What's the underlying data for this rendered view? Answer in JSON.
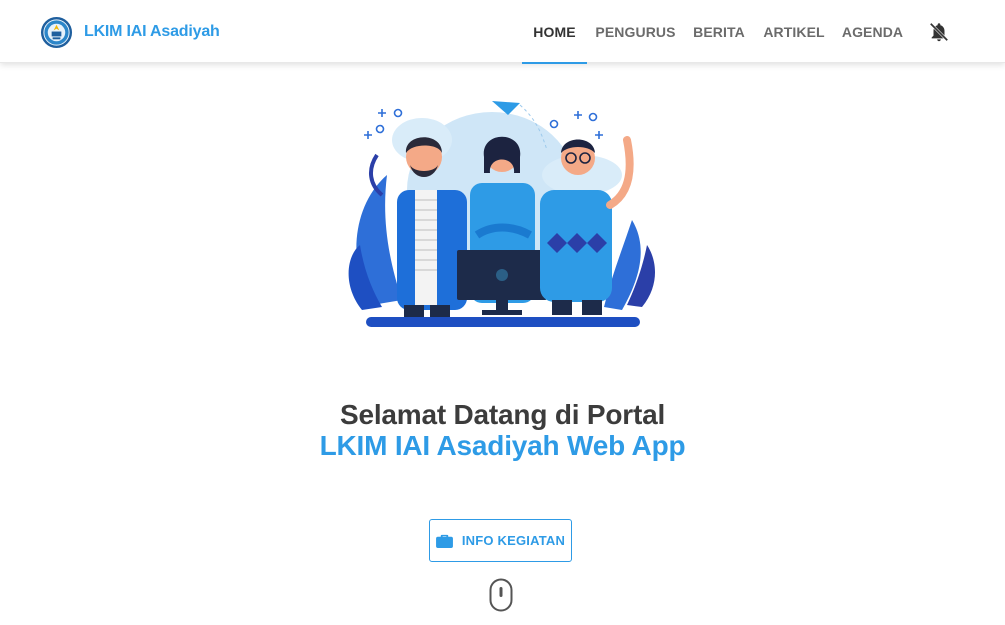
{
  "brand": {
    "name": "LKIM IAI Asadiyah",
    "logo_icon": "university-seal-icon"
  },
  "nav": {
    "items": [
      {
        "label": "HOME",
        "active": true
      },
      {
        "label": "PENGURUS",
        "active": false
      },
      {
        "label": "BERITA",
        "active": false
      },
      {
        "label": "ARTIKEL",
        "active": false
      },
      {
        "label": "AGENDA",
        "active": false
      }
    ],
    "notification_icon": "bell-off-icon"
  },
  "hero": {
    "illustration": "team-illustration",
    "title_line1": "Selamat Datang di Portal",
    "title_line2": "LKIM IAI Asadiyah Web App",
    "cta_label": "INFO KEGIATAN",
    "cta_icon": "briefcase-icon",
    "scroll_icon": "mouse-scroll-icon"
  },
  "colors": {
    "accent": "#2e9be6",
    "text_dark": "#3c3c3c",
    "nav_text": "#6b6b6b"
  }
}
